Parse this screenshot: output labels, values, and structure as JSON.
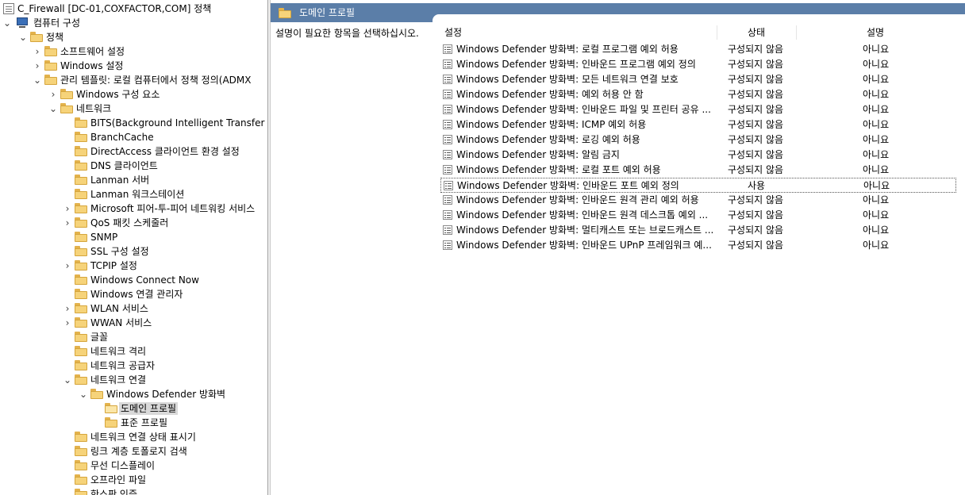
{
  "tree": {
    "root_title": "C_Firewall [DC-01,COXFACTOR,COM] 정책",
    "nodes": [
      {
        "label": "컴퓨터 구성",
        "indent": 0,
        "expander": "open",
        "icon": "computer-icon"
      },
      {
        "label": "정책",
        "indent": 1,
        "expander": "open",
        "icon": "folder-icon"
      },
      {
        "label": "소프트웨어 설정",
        "indent": 2,
        "expander": "closed",
        "icon": "folder-icon"
      },
      {
        "label": "Windows 설정",
        "indent": 2,
        "expander": "closed",
        "icon": "folder-icon"
      },
      {
        "label": "관리 템플릿: 로컬 컴퓨터에서 정책 정의(ADMX",
        "indent": 2,
        "expander": "open",
        "icon": "folder-icon"
      },
      {
        "label": "Windows 구성 요소",
        "indent": 3,
        "expander": "closed",
        "icon": "folder-icon"
      },
      {
        "label": "네트워크",
        "indent": 3,
        "expander": "open",
        "icon": "folder-icon"
      },
      {
        "label": "BITS(Background Intelligent Transfer S",
        "indent": 4,
        "expander": "none",
        "icon": "folder-icon"
      },
      {
        "label": "BranchCache",
        "indent": 4,
        "expander": "none",
        "icon": "folder-icon"
      },
      {
        "label": "DirectAccess 클라이언트 환경 설정",
        "indent": 4,
        "expander": "none",
        "icon": "folder-icon"
      },
      {
        "label": "DNS 클라이언트",
        "indent": 4,
        "expander": "none",
        "icon": "folder-icon"
      },
      {
        "label": "Lanman 서버",
        "indent": 4,
        "expander": "none",
        "icon": "folder-icon"
      },
      {
        "label": "Lanman 워크스테이션",
        "indent": 4,
        "expander": "none",
        "icon": "folder-icon"
      },
      {
        "label": "Microsoft 피어-투-피어 네트워킹 서비스",
        "indent": 4,
        "expander": "closed",
        "icon": "folder-icon"
      },
      {
        "label": "QoS 패킷 스케줄러",
        "indent": 4,
        "expander": "closed",
        "icon": "folder-icon"
      },
      {
        "label": "SNMP",
        "indent": 4,
        "expander": "none",
        "icon": "folder-icon"
      },
      {
        "label": "SSL 구성 설정",
        "indent": 4,
        "expander": "none",
        "icon": "folder-icon"
      },
      {
        "label": "TCPIP 설정",
        "indent": 4,
        "expander": "closed",
        "icon": "folder-icon"
      },
      {
        "label": "Windows Connect Now",
        "indent": 4,
        "expander": "none",
        "icon": "folder-icon"
      },
      {
        "label": "Windows 연결 관리자",
        "indent": 4,
        "expander": "none",
        "icon": "folder-icon"
      },
      {
        "label": "WLAN 서비스",
        "indent": 4,
        "expander": "closed",
        "icon": "folder-icon"
      },
      {
        "label": "WWAN 서비스",
        "indent": 4,
        "expander": "closed",
        "icon": "folder-icon"
      },
      {
        "label": "글꼴",
        "indent": 4,
        "expander": "none",
        "icon": "folder-icon"
      },
      {
        "label": "네트워크 격리",
        "indent": 4,
        "expander": "none",
        "icon": "folder-icon"
      },
      {
        "label": "네트워크 공급자",
        "indent": 4,
        "expander": "none",
        "icon": "folder-icon"
      },
      {
        "label": "네트워크 연결",
        "indent": 4,
        "expander": "open",
        "icon": "folder-icon"
      },
      {
        "label": "Windows Defender 방화벽",
        "indent": 5,
        "expander": "open",
        "icon": "folder-icon"
      },
      {
        "label": "도메인 프로필",
        "indent": 6,
        "expander": "none",
        "icon": "folder-open-icon",
        "selected": true
      },
      {
        "label": "표준 프로필",
        "indent": 6,
        "expander": "none",
        "icon": "folder-icon"
      },
      {
        "label": "네트워크 연결 상태 표시기",
        "indent": 4,
        "expander": "none",
        "icon": "folder-icon"
      },
      {
        "label": "링크 계층 토폴로지 검색",
        "indent": 4,
        "expander": "none",
        "icon": "folder-icon"
      },
      {
        "label": "무선 디스플레이",
        "indent": 4,
        "expander": "none",
        "icon": "folder-icon"
      },
      {
        "label": "오프라인 파일",
        "indent": 4,
        "expander": "none",
        "icon": "folder-icon"
      },
      {
        "label": "한스판 인증",
        "indent": 4,
        "expander": "none",
        "icon": "folder-icon"
      }
    ]
  },
  "right": {
    "header_title": "도메인 프로필",
    "description": "설명이 필요한 항목을 선택하십시오.",
    "columns": {
      "setting": "설정",
      "state": "상태",
      "comment": "설명"
    },
    "rows": [
      {
        "name": "Windows Defender 방화벽: 로컬 프로그램 예외 허용",
        "state": "구성되지 않음",
        "comment": "아니요"
      },
      {
        "name": "Windows Defender 방화벽: 인바운드 프로그램 예외 정의",
        "state": "구성되지 않음",
        "comment": "아니요"
      },
      {
        "name": "Windows Defender 방화벽: 모든 네트워크 연결 보호",
        "state": "구성되지 않음",
        "comment": "아니요"
      },
      {
        "name": "Windows Defender 방화벽: 예외 허용 안 함",
        "state": "구성되지 않음",
        "comment": "아니요"
      },
      {
        "name": "Windows Defender 방화벽: 인바운드 파일 및 프린터 공유 ...",
        "state": "구성되지 않음",
        "comment": "아니요"
      },
      {
        "name": "Windows Defender 방화벽: ICMP 예외 허용",
        "state": "구성되지 않음",
        "comment": "아니요"
      },
      {
        "name": "Windows Defender 방화벽: 로깅 예외 허용",
        "state": "구성되지 않음",
        "comment": "아니요"
      },
      {
        "name": "Windows Defender 방화벽: 알림 금지",
        "state": "구성되지 않음",
        "comment": "아니요"
      },
      {
        "name": "Windows Defender 방화벽: 로컬 포트 예외 허용",
        "state": "구성되지 않음",
        "comment": "아니요"
      },
      {
        "name": "Windows Defender 방화벽: 인바운드 포트 예외 정의",
        "state": "사용",
        "comment": "아니요",
        "focused": true
      },
      {
        "name": "Windows Defender 방화벽: 인바운드 원격 관리 예외 허용",
        "state": "구성되지 않음",
        "comment": "아니요"
      },
      {
        "name": "Windows Defender 방화벽: 인바운드 원격 데스크톱 예외 ...",
        "state": "구성되지 않음",
        "comment": "아니요"
      },
      {
        "name": "Windows Defender 방화벽: 멀티캐스트 또는 브로드캐스트 ...",
        "state": "구성되지 않음",
        "comment": "아니요"
      },
      {
        "name": "Windows Defender 방화벽: 인바운드 UPnP 프레임워크 예...",
        "state": "구성되지 않음",
        "comment": "아니요"
      }
    ]
  }
}
